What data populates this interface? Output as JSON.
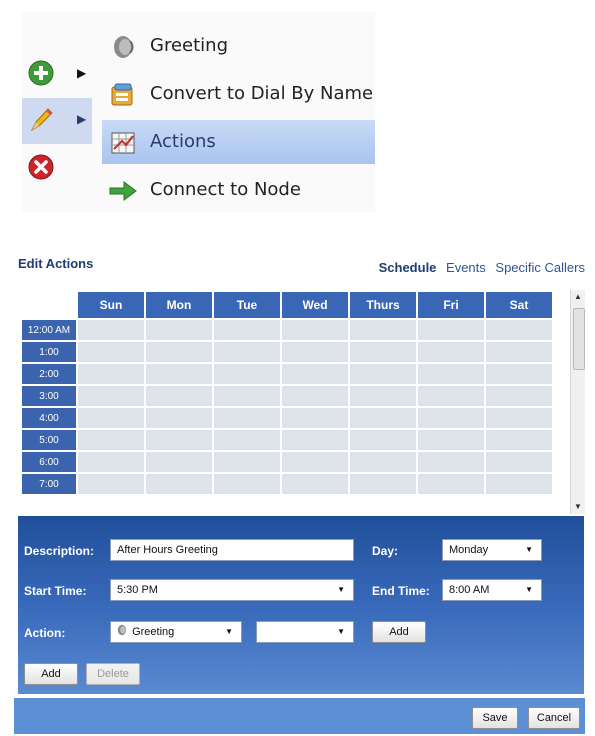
{
  "context_menu": {
    "items": [
      {
        "label": "Greeting",
        "icon": "greeting-icon"
      },
      {
        "label": "Convert to Dial By Name",
        "icon": "convert-icon"
      },
      {
        "label": "Actions",
        "icon": "actions-icon",
        "highlighted": true
      },
      {
        "label": "Connect to Node",
        "icon": "green-arrow-icon"
      }
    ],
    "side_buttons": [
      "add-icon",
      "edit-pencil-icon",
      "delete-icon"
    ]
  },
  "dialog": {
    "title": "Edit Actions",
    "tabs": [
      {
        "label": "Schedule",
        "active": true
      },
      {
        "label": "Events",
        "active": false
      },
      {
        "label": "Specific Callers",
        "active": false
      }
    ],
    "schedule": {
      "days": [
        "Sun",
        "Mon",
        "Tue",
        "Wed",
        "Thurs",
        "Fri",
        "Sat"
      ],
      "times": [
        "12:00 AM",
        "1:00",
        "2:00",
        "3:00",
        "4:00",
        "5:00",
        "6:00",
        "7:00"
      ]
    },
    "form": {
      "description_label": "Description:",
      "description_value": "After Hours Greeting",
      "day_label": "Day:",
      "day_value": "Monday",
      "start_time_label": "Start Time:",
      "start_time_value": "5:30 PM",
      "end_time_label": "End Time:",
      "end_time_value": "8:00 AM",
      "action_label": "Action:",
      "action_value": "Greeting",
      "action_secondary_value": "",
      "action_add_label": "Add",
      "add_label": "Add",
      "delete_label": "Delete"
    },
    "footer": {
      "save_label": "Save",
      "cancel_label": "Cancel"
    }
  },
  "colors": {
    "header_blue": "#3a67b5",
    "panel_blue": "#2f5fab",
    "menu_highlight": "#b9cff2",
    "grid_cell": "#dfe4ea"
  }
}
